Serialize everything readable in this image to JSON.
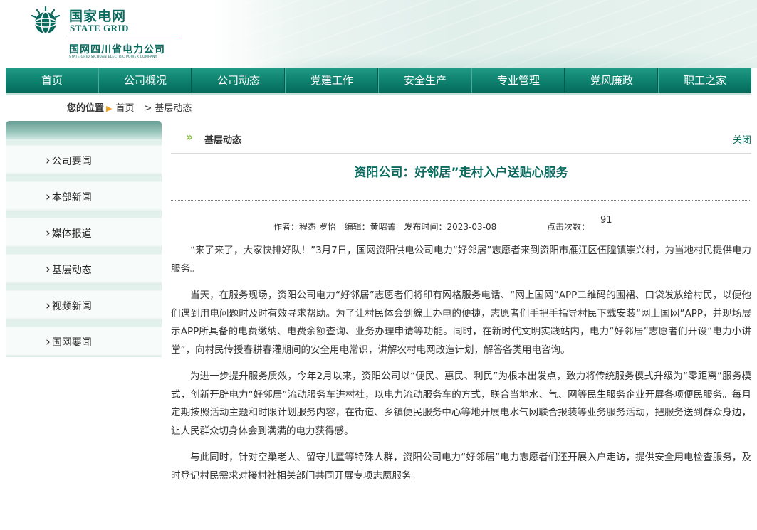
{
  "header": {
    "logo_cn": "国家电网",
    "logo_en": "STATE GRID",
    "sub_cn": "国网四川省电力公司",
    "sub_en": "STATE GRID SICHUAN ELECTRIC POWER COMPANY"
  },
  "nav": {
    "items": [
      "首页",
      "公司概况",
      "公司动态",
      "党建工作",
      "安全生产",
      "专业管理",
      "党风廉政",
      "职工之家"
    ]
  },
  "breadcrumb": {
    "label": "您的位置",
    "home": "首页",
    "current": "基层动态"
  },
  "sidebar": {
    "items": [
      "公司要闻",
      "本部新闻",
      "媒体报道",
      "基层动态",
      "视频新闻",
      "国网要闻"
    ]
  },
  "section": {
    "title": "基层动态",
    "close_label": "关闭"
  },
  "article": {
    "title": "资阳公司：好邻居”走村入户送贴心服务",
    "author": "作者：程杰 罗怡",
    "editor": "编辑：黄昭菁",
    "date": "发布时间：2023-03-08",
    "clicks_label": "点击次数：",
    "clicks": "91",
    "paragraphs": [
      "“来了来了，大家快排好队！”3月7日，国网资阳供电公司电力“好邻居”志愿者来到资阳市雁江区伍隍镇崇兴村，为当地村民提供电力服务。",
      "当天，在服务现场，资阳公司电力“好邻居”志愿者们将印有网格服务电话、“网上国网”APP二维码的围裙、口袋发放给村民，以便他们遇到用电问题时及时有效寻求帮助。为了让村民体会到線上办电的便捷，志愿者们手把手指导村民下载安装“网上国网”APP，并现场展示APP所具备的电费缴纳、电费余额查询、业务办理申请等功能。同时，在新时代文明实践站内，电力“好邻居”志愿者们开设“电力小讲堂”，向村民传授春耕春灌期间的安全用电常识，讲解农村电网改造计划，解答各类用电咨询。",
      "为进一步提升服务质效，今年2月以来，资阳公司以“便民、惠民、利民”为根本出发点，致力将传统服务模式升级为“零距离”服务模式，创新开辟电力“好邻居”流动服务车进村社，以电力流动服务车的方式，联合当地水、气、网等民生服务企业开展各项便民服务。每月定期按照活动主题和时限计划服务内容，在街道、乡镇便民服务中心等地开展电水气网联合报装等业务服务活动，把服务送到群众身边，让人民群众切身体会到满满的电力获得感。",
      "与此同时，针对空巢老人、留守儿童等特殊人群，资阳公司电力“好邻居”电力志愿者们还开展入户走访，提供安全用电检查服务，及时登记村民需求对接村社相关部门共同开展专项志愿服务。"
    ]
  },
  "colors": {
    "brand_green": "#0a6a5e",
    "nav_green": "#0d7f6c",
    "accent_orange": "#f0a020",
    "chevron_green": "#86bd3c"
  }
}
